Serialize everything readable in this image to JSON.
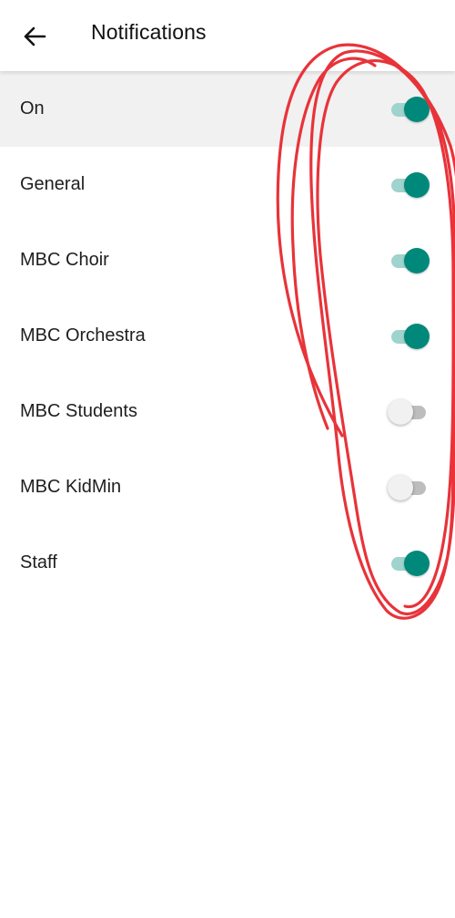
{
  "header": {
    "title": "Notifications",
    "back_icon": "arrow-left-icon"
  },
  "colors": {
    "accent": "#00897b",
    "highlight_row": "#f1f1f1",
    "annotation": "#e8333a"
  },
  "settings": [
    {
      "label": "On",
      "enabled": true,
      "highlighted": true
    },
    {
      "label": "General",
      "enabled": true,
      "highlighted": false
    },
    {
      "label": "MBC Choir",
      "enabled": true,
      "highlighted": false
    },
    {
      "label": "MBC Orchestra",
      "enabled": true,
      "highlighted": false
    },
    {
      "label": "MBC Students",
      "enabled": false,
      "highlighted": false
    },
    {
      "label": "MBC KidMin",
      "enabled": false,
      "highlighted": false
    },
    {
      "label": "Staff",
      "enabled": true,
      "highlighted": false
    }
  ]
}
